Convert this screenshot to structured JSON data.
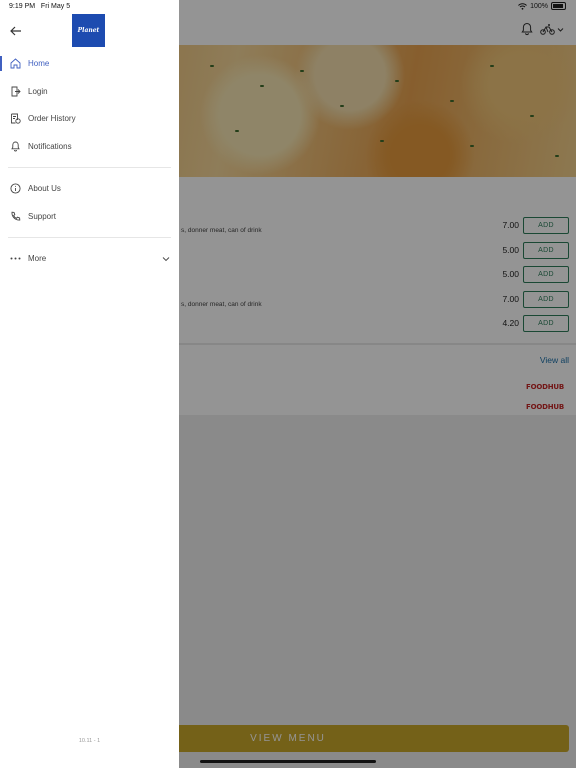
{
  "status": {
    "time": "9:19 PM",
    "date": "Fri May 5",
    "battery": "100%"
  },
  "drawer": {
    "logo_text": "Planet",
    "items": [
      {
        "label": "Home",
        "icon": "home-icon"
      },
      {
        "label": "Login",
        "icon": "login-icon"
      },
      {
        "label": "Order History",
        "icon": "order-history-icon"
      },
      {
        "label": "Notifications",
        "icon": "bell-icon"
      },
      {
        "label": "About Us",
        "icon": "info-icon"
      },
      {
        "label": "Support",
        "icon": "phone-icon"
      },
      {
        "label": "More",
        "icon": "more-dots-icon"
      }
    ],
    "version": "10.11 - 1"
  },
  "deals": [
    {
      "desc": "s, donner meat, can of drink",
      "price": "7.00",
      "button": "ADD"
    },
    {
      "desc": "",
      "price": "5.00",
      "button": "ADD"
    },
    {
      "desc": "",
      "price": "5.00",
      "button": "ADD"
    },
    {
      "desc": "s, donner meat, can of drink",
      "price": "7.00",
      "button": "ADD"
    },
    {
      "desc": "",
      "price": "4.20",
      "button": "ADD"
    }
  ],
  "reviews": {
    "view_all": "View all",
    "sources": [
      "FOODHUB",
      "FOODHUB"
    ]
  },
  "footer": {
    "view_menu": "VIEW MENU"
  },
  "colors": {
    "accent": "#4060c0",
    "add_green": "#2d7d5a",
    "view_menu_gold": "#c9a72a",
    "logo_blue": "#1d4bb0"
  }
}
